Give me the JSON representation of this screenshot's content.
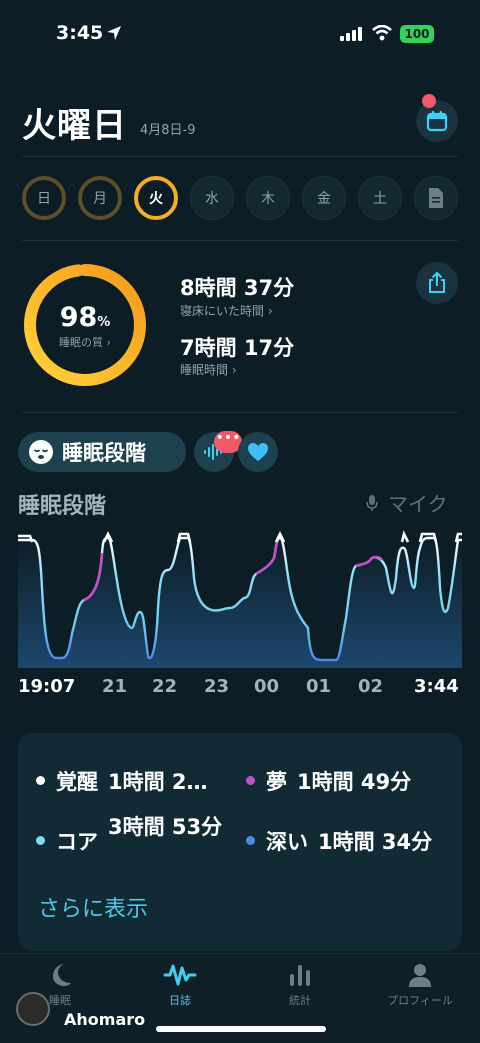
{
  "status": {
    "time": "3:45",
    "battery": "100"
  },
  "header": {
    "day": "火曜日",
    "date": "4月8日-9"
  },
  "week": [
    {
      "label": "日",
      "state": "dim"
    },
    {
      "label": "月",
      "state": "dim"
    },
    {
      "label": "火",
      "state": "active"
    },
    {
      "label": "水",
      "state": "none"
    },
    {
      "label": "木",
      "state": "none"
    },
    {
      "label": "金",
      "state": "none"
    },
    {
      "label": "土",
      "state": "none"
    }
  ],
  "score": {
    "value": "98",
    "unit": "%",
    "label": "睡眠の質 ›",
    "fraction": 0.98
  },
  "stats": {
    "in_bed_value": "8時間 37分",
    "in_bed_label": "寝床にいた時間 ›",
    "sleep_value": "7時間 17分",
    "sleep_label": "睡眠時間 ›"
  },
  "chips": {
    "stage_label": "睡眠段階",
    "badge": "•••"
  },
  "chart": {
    "title": "睡眠段階",
    "mic_label": "マイク",
    "x_labels": [
      "19:07",
      "21",
      "22",
      "23",
      "00",
      "01",
      "02",
      "3:44"
    ]
  },
  "summary": {
    "awake_name": "覚醒",
    "awake_value": "1時間 2…",
    "dream_name": "夢",
    "dream_value": "1時間 49分",
    "core_name": "コア",
    "core_value": "3時間 53分",
    "deep_name": "深い",
    "deep_value": "1時間 34分",
    "more": "さらに表示"
  },
  "tabs": {
    "sleep": "睡眠",
    "journal": "日誌",
    "stats": "統計",
    "profile": "プロフィール"
  },
  "watermark": {
    "text": "Ahomaro"
  },
  "colors": {
    "background": "#0d1d25",
    "accent": "#3fd0f2",
    "score": "#f5ae22",
    "awake": "#ffffff",
    "dream": "#c050c8",
    "core": "#7fd8f5",
    "deep": "#4a8be6"
  }
}
